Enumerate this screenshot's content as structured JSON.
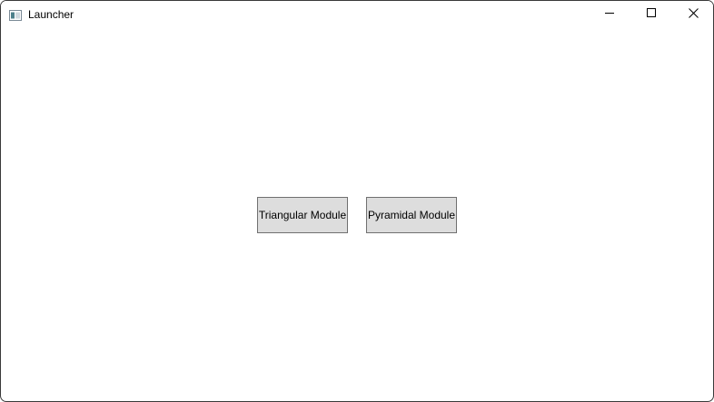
{
  "window": {
    "title": "Launcher",
    "app_icon": "window-icon"
  },
  "caption_buttons": {
    "minimize_icon": "minimize-icon",
    "maximize_icon": "maximize-icon",
    "close_icon": "close-icon"
  },
  "main": {
    "buttons": [
      {
        "label": "Triangular Module"
      },
      {
        "label": "Pyramidal Module"
      }
    ]
  },
  "colors": {
    "button_background": "#dddddd",
    "button_border": "#707070",
    "window_background": "#ffffff"
  }
}
